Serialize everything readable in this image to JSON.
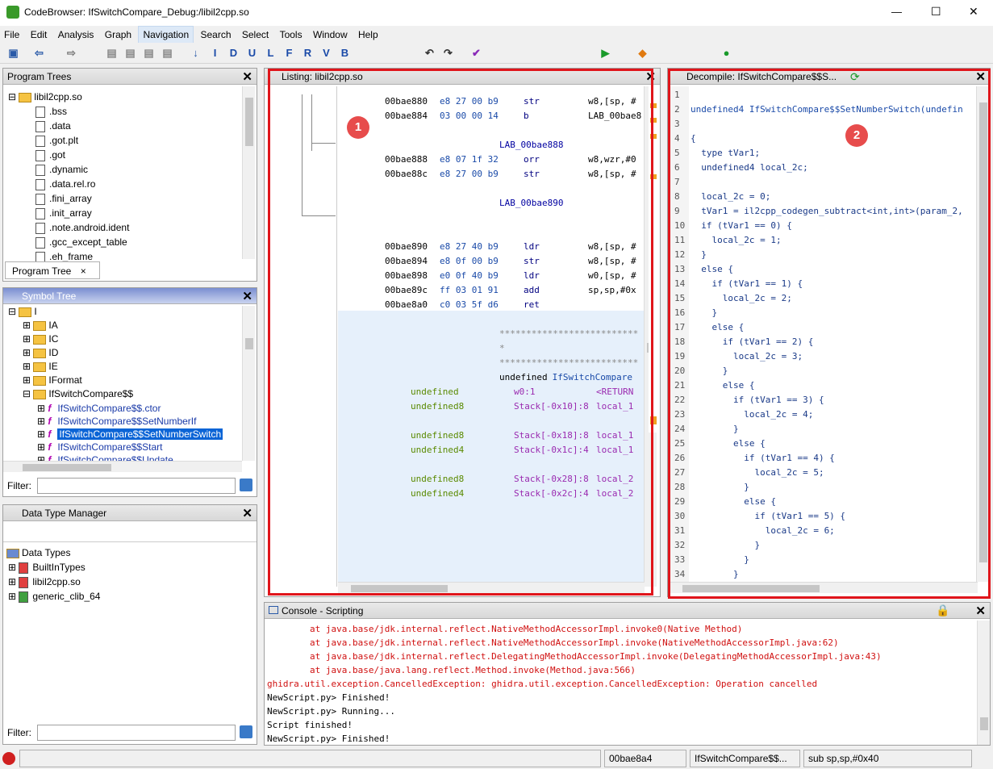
{
  "window": {
    "title": "CodeBrowser: IfSwitchCompare_Debug:/libil2cpp.so",
    "controls": {
      "minimize": "—",
      "maximize": "☐",
      "close": "✕"
    }
  },
  "menu": [
    "File",
    "Edit",
    "Analysis",
    "Graph",
    "Navigation",
    "Search",
    "Select",
    "Tools",
    "Window",
    "Help"
  ],
  "toolbar_letters": [
    "I",
    "D",
    "U",
    "L",
    "F",
    "R",
    "V",
    "B"
  ],
  "program_trees": {
    "title": "Program Trees",
    "root": "libil2cpp.so",
    "items": [
      ".bss",
      ".data",
      ".got.plt",
      ".got",
      ".dynamic",
      ".data.rel.ro",
      ".fini_array",
      ".init_array",
      ".note.android.ident",
      ".gcc_except_table",
      ".eh_frame"
    ],
    "tab_label": "Program Tree",
    "tab_close": "×"
  },
  "symbol_tree": {
    "title": "Symbol Tree",
    "root": "I",
    "folders": [
      "IA",
      "IC",
      "ID",
      "IE",
      "IFormat",
      "IfSwitchCompare$$"
    ],
    "functions": [
      "IfSwitchCompare$$.ctor",
      "IfSwitchCompare$$SetNumberIf",
      "IfSwitchCompare$$SetNumberSwitch",
      "IfSwitchCompare$$Start",
      "IfSwitchCompare$$Update"
    ],
    "selected_function": "IfSwitchCompare$$SetNumberSwitch",
    "func_glyph": "f",
    "filter_label": "Filter:"
  },
  "data_type_manager": {
    "title": "Data Type Manager",
    "root": "Data Types",
    "items": [
      "BuiltInTypes",
      "libil2cpp.so",
      "generic_clib_64"
    ],
    "filter_label": "Filter:"
  },
  "listing": {
    "title": "Listing:  libil2cpp.so",
    "badge": "1",
    "rows_a": [
      {
        "addr": "00bae880",
        "bytes": "e8 27 00 b9",
        "mnem": "str",
        "ops": "w8,[sp, #"
      },
      {
        "addr": "00bae884",
        "bytes": "03 00 00 14",
        "mnem": "b",
        "ops": "LAB_00bae8"
      }
    ],
    "label1": "LAB_00bae888",
    "rows_b": [
      {
        "addr": "00bae888",
        "bytes": "e8 07 1f 32",
        "mnem": "orr",
        "ops": "w8,wzr,#0"
      },
      {
        "addr": "00bae88c",
        "bytes": "e8 27 00 b9",
        "mnem": "str",
        "ops": "w8,[sp, #"
      }
    ],
    "label2": "LAB_00bae890",
    "rows_c": [
      {
        "addr": "00bae890",
        "bytes": "e8 27 40 b9",
        "mnem": "ldr",
        "ops": "w8,[sp, #"
      },
      {
        "addr": "00bae894",
        "bytes": "e8 0f 00 b9",
        "mnem": "str",
        "ops": "w8,[sp, #"
      },
      {
        "addr": "00bae898",
        "bytes": "e0 0f 40 b9",
        "mnem": "ldr",
        "ops": "w0,[sp, #"
      },
      {
        "addr": "00bae89c",
        "bytes": "ff 03 01 91",
        "mnem": "add",
        "ops": "sp,sp,#0x"
      },
      {
        "addr": "00bae8a0",
        "bytes": "c0 03 5f d6",
        "mnem": "ret",
        "ops": ""
      }
    ],
    "stars": "**************************",
    "star_single": "*",
    "func_sig_type": "undefined",
    "func_sig_name": "IfSwitchCompare",
    "params": [
      {
        "type": "undefined",
        "loc": "w0:1",
        "name": "<RETURN"
      },
      {
        "type": "undefined8",
        "loc": "Stack[-0x10]:8",
        "name": "local_1"
      },
      {
        "type": "undefined8",
        "loc": "Stack[-0x18]:8",
        "name": "local_1"
      },
      {
        "type": "undefined4",
        "loc": "Stack[-0x1c]:4",
        "name": "local_1"
      },
      {
        "type": "undefined8",
        "loc": "Stack[-0x28]:8",
        "name": "local_2"
      },
      {
        "type": "undefined4",
        "loc": "Stack[-0x2c]:4",
        "name": "local_2"
      }
    ]
  },
  "decompile": {
    "title": "Decompile: IfSwitchCompare$$S...",
    "badge": "2",
    "lines": [
      {
        "n": "1",
        "t": ""
      },
      {
        "n": "2",
        "t": "undefined4 IfSwitchCompare$$SetNumberSwitch(undefin"
      },
      {
        "n": "3",
        "t": ""
      },
      {
        "n": "4",
        "t": "{"
      },
      {
        "n": "5",
        "t": "  type tVar1;"
      },
      {
        "n": "6",
        "t": "  undefined4 local_2c;"
      },
      {
        "n": "7",
        "t": ""
      },
      {
        "n": "8",
        "t": "  local_2c = 0;"
      },
      {
        "n": "9",
        "t": "  tVar1 = il2cpp_codegen_subtract<int,int>(param_2,"
      },
      {
        "n": "10",
        "t": "  if (tVar1 == 0) {"
      },
      {
        "n": "11",
        "t": "    local_2c = 1;"
      },
      {
        "n": "12",
        "t": "  }"
      },
      {
        "n": "13",
        "t": "  else {"
      },
      {
        "n": "14",
        "t": "    if (tVar1 == 1) {"
      },
      {
        "n": "15",
        "t": "      local_2c = 2;"
      },
      {
        "n": "16",
        "t": "    }"
      },
      {
        "n": "17",
        "t": "    else {"
      },
      {
        "n": "18",
        "t": "      if (tVar1 == 2) {"
      },
      {
        "n": "19",
        "t": "        local_2c = 3;"
      },
      {
        "n": "20",
        "t": "      }"
      },
      {
        "n": "21",
        "t": "      else {"
      },
      {
        "n": "22",
        "t": "        if (tVar1 == 3) {"
      },
      {
        "n": "23",
        "t": "          local_2c = 4;"
      },
      {
        "n": "24",
        "t": "        }"
      },
      {
        "n": "25",
        "t": "        else {"
      },
      {
        "n": "26",
        "t": "          if (tVar1 == 4) {"
      },
      {
        "n": "27",
        "t": "            local_2c = 5;"
      },
      {
        "n": "28",
        "t": "          }"
      },
      {
        "n": "29",
        "t": "          else {"
      },
      {
        "n": "30",
        "t": "            if (tVar1 == 5) {"
      },
      {
        "n": "31",
        "t": "              local_2c = 6;"
      },
      {
        "n": "32",
        "t": "            }"
      },
      {
        "n": "33",
        "t": "          }"
      },
      {
        "n": "34",
        "t": "        }"
      }
    ]
  },
  "console": {
    "title": "Console - Scripting",
    "lines": [
      {
        "t": "        at java.base/jdk.internal.reflect.NativeMethodAccessorImpl.invoke0(Native Method)",
        "err": true
      },
      {
        "t": "        at java.base/jdk.internal.reflect.NativeMethodAccessorImpl.invoke(NativeMethodAccessorImpl.java:62)",
        "err": true
      },
      {
        "t": "        at java.base/jdk.internal.reflect.DelegatingMethodAccessorImpl.invoke(DelegatingMethodAccessorImpl.java:43)",
        "err": true
      },
      {
        "t": "        at java.base/java.lang.reflect.Method.invoke(Method.java:566)",
        "err": true
      },
      {
        "t": "ghidra.util.exception.CancelledException: ghidra.util.exception.CancelledException: Operation cancelled",
        "err": true
      },
      {
        "t": "NewScript.py> Finished!",
        "err": false
      },
      {
        "t": "NewScript.py> Running...",
        "err": false
      },
      {
        "t": "Script finished!",
        "err": false
      },
      {
        "t": "NewScript.py> Finished!",
        "err": false
      }
    ]
  },
  "status": {
    "address": "00bae8a4",
    "function": "IfSwitchCompare$$...",
    "instruction": "sub sp,sp,#0x40"
  },
  "colors": {
    "highlight_box": "#e0151b",
    "badge": "#e74c4c",
    "selection": "#0a64d6"
  }
}
